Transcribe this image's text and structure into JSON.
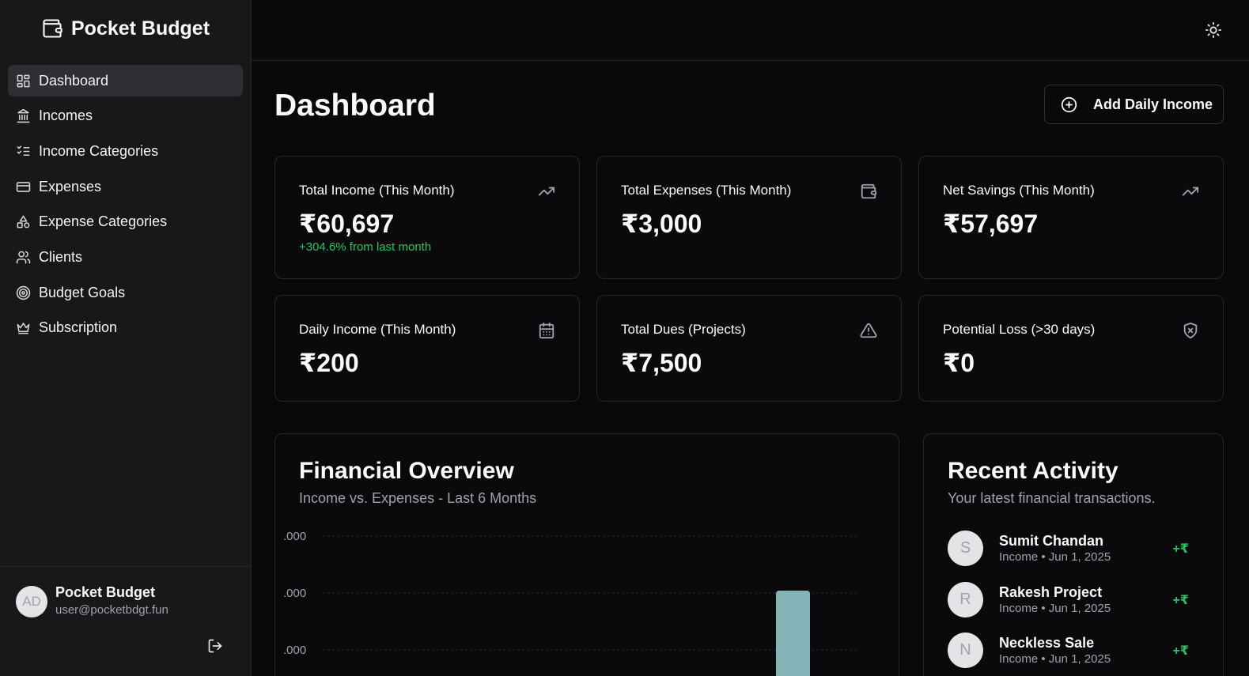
{
  "app": {
    "name": "Pocket Budget",
    "icon": "wallet-icon"
  },
  "sidebar": {
    "items": [
      {
        "label": "Dashboard",
        "icon": "layout-grid-icon",
        "active": true
      },
      {
        "label": "Incomes",
        "icon": "bank-icon"
      },
      {
        "label": "Income Categories",
        "icon": "list-checks-icon"
      },
      {
        "label": "Expenses",
        "icon": "credit-card-icon"
      },
      {
        "label": "Expense Categories",
        "icon": "shapes-icon"
      },
      {
        "label": "Clients",
        "icon": "users-icon"
      },
      {
        "label": "Budget Goals",
        "icon": "target-icon"
      },
      {
        "label": "Subscription",
        "icon": "crown-icon"
      }
    ]
  },
  "user": {
    "initials": "AD",
    "name": "Pocket Budget",
    "email": "user@pocketbdgt.fun"
  },
  "header": {
    "theme_toggle_icon": "sun-icon"
  },
  "page": {
    "title": "Dashboard",
    "add_button_label": "Add Daily Income",
    "add_button_icon": "plus-circle-icon"
  },
  "stats": [
    {
      "label": "Total Income (This Month)",
      "value": "₹60,697",
      "change": "+304.6% from last month",
      "icon": "trending-up-icon"
    },
    {
      "label": "Total Expenses (This Month)",
      "value": "₹3,000",
      "icon": "wallet-icon"
    },
    {
      "label": "Net Savings (This Month)",
      "value": "₹57,697",
      "icon": "trending-up-icon"
    },
    {
      "label": "Daily Income (This Month)",
      "value": "₹200",
      "icon": "calendar-icon"
    },
    {
      "label": "Total Dues (Projects)",
      "value": "₹7,500",
      "icon": "alert-triangle-icon"
    },
    {
      "label": "Potential Loss (>30 days)",
      "value": "₹0",
      "icon": "shield-x-icon"
    }
  ],
  "overview": {
    "title": "Financial Overview",
    "subtitle": "Income vs. Expenses - Last 6 Months"
  },
  "chart_data": {
    "type": "bar",
    "title": "Financial Overview",
    "subtitle": "Income vs. Expenses - Last 6 Months",
    "visible_tick_labels": [
      ".000",
      ".000",
      ".000"
    ],
    "bar_color": "#84b4b8",
    "note_visible_bars": "single bar partially visible near right side of the plot area"
  },
  "recent": {
    "title": "Recent Activity",
    "subtitle": "Your latest financial transactions.",
    "items": [
      {
        "initial": "S",
        "name": "Sumit Chandan",
        "meta": "Income • Jun 1, 2025",
        "amount": "+₹"
      },
      {
        "initial": "R",
        "name": "Rakesh Project",
        "meta": "Income • Jun 1, 2025",
        "amount": "+₹"
      },
      {
        "initial": "N",
        "name": "Neckless Sale",
        "meta": "Income • Jun 1, 2025",
        "amount": "+₹"
      }
    ]
  },
  "colors": {
    "background": "#09090b",
    "sidebar": "#18181b",
    "positive": "#22c55e",
    "bar": "#84b4b8"
  }
}
